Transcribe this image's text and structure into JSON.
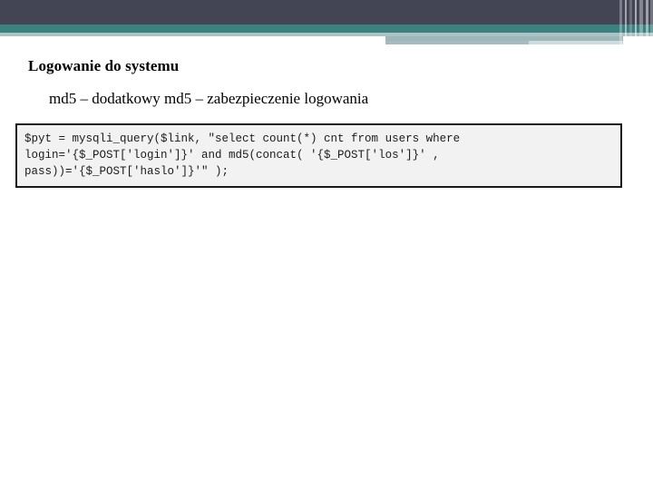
{
  "slide": {
    "title": "Logowanie do systemu",
    "subtitle": "md5 – dodatkowy md5 – zabezpieczenie logowania",
    "code": "$pyt = mysqli_query($link, \"select count(*) cnt from users where login='{$_POST['login']}' and md5(concat( '{$_POST['los']}' , pass))='{$_POST['haslo']}'\" );"
  },
  "decoration": {
    "navy_color": "#434555",
    "teal_color": "#3e7f80",
    "light_teal_color": "#a9c4c5",
    "accent_color": "#9fb6bb",
    "accent_light_color": "#cfdcdf"
  },
  "code_block": {
    "background_color": "#f2f2f2",
    "border_color": "#1a1a1a"
  }
}
